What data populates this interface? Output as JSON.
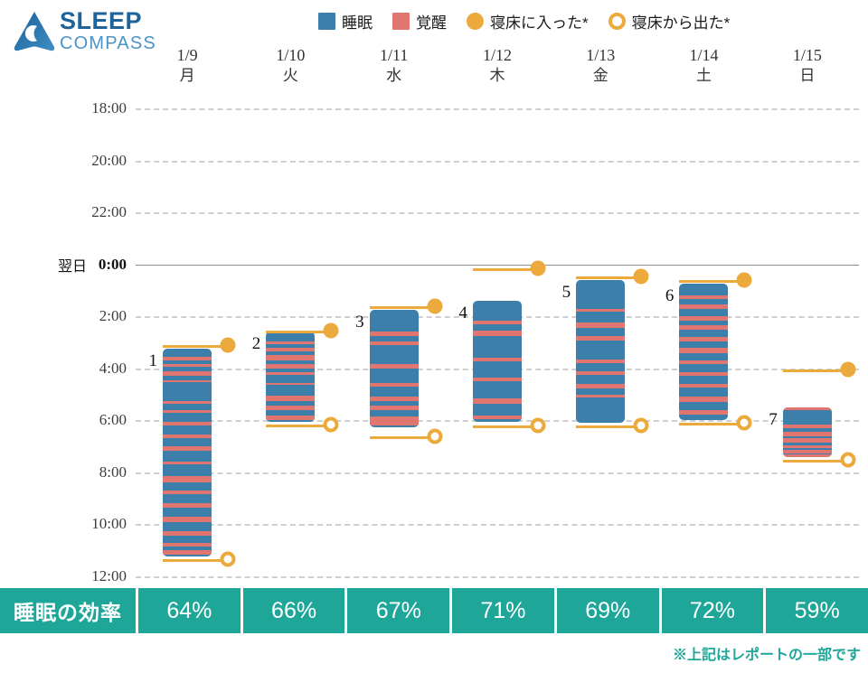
{
  "brand": {
    "name_line1": "SLEEP",
    "name_line2": "COMPASS",
    "logo_icon": "sleep-compass-moon-arrow-logo",
    "color_primary": "#1f6398",
    "color_secondary": "#4b94c8"
  },
  "legend": {
    "items": [
      {
        "label": "睡眠",
        "marker": "square",
        "color": "#3d7fab",
        "icon": "sleep-swatch-icon"
      },
      {
        "label": "覚醒",
        "marker": "square",
        "color": "#e0766f",
        "icon": "awake-swatch-icon"
      },
      {
        "label": "寝床に入った*",
        "marker": "dot-filled",
        "color": "#eca93c",
        "icon": "bed-in-dot-icon"
      },
      {
        "label": "寝床から出た*",
        "marker": "dot-hollow",
        "color": "#eca93c",
        "icon": "bed-out-dot-icon"
      }
    ]
  },
  "efficiency_row": {
    "label": "睡眠の効率",
    "values": [
      "64%",
      "66%",
      "67%",
      "71%",
      "69%",
      "72%",
      "59%"
    ],
    "color": "#1ea699"
  },
  "footer": {
    "note": "※上記はレポートの一部です",
    "color": "#1ea699"
  },
  "chart_data": {
    "type": "bar",
    "title": "",
    "subtitle": "",
    "xlabel": "",
    "ylabel": "",
    "grid": true,
    "legend_position": "top",
    "next_day_marker": "翌日",
    "next_day_marker_at": "0:00",
    "categories": [
      "1/9",
      "1/10",
      "1/11",
      "1/12",
      "1/13",
      "1/14",
      "1/15"
    ],
    "day_of_week": [
      "月",
      "火",
      "水",
      "木",
      "金",
      "土",
      "日"
    ],
    "ytick_labels": [
      "18:00",
      "20:00",
      "22:00",
      "0:00",
      "2:00",
      "4:00",
      "6:00",
      "8:00",
      "10:00",
      "12:00"
    ],
    "ytick_hours": [
      18,
      20,
      22,
      24,
      26,
      28,
      30,
      32,
      34,
      36
    ],
    "ylim_hours": [
      18,
      36
    ],
    "y_axis_note": "hours measured from 18:00 of the labelled day; 24 = 0:00 next day",
    "sleep_color": "#3d7fab",
    "awake_color": "#e0766f",
    "marker_color": "#eca93c",
    "series": [
      {
        "name": "1/9",
        "index_label": "1",
        "bed_in_hour": 27.1,
        "bed_out_hour": 35.35,
        "sleep_start_hour": 27.25,
        "sleep_end_hour": 35.25,
        "efficiency": "64%",
        "awake_segments": [
          [
            27.55,
            27.68
          ],
          [
            27.82,
            27.95
          ],
          [
            28.1,
            28.3
          ],
          [
            28.45,
            28.52
          ],
          [
            29.25,
            29.38
          ],
          [
            29.6,
            29.72
          ],
          [
            30.05,
            30.2
          ],
          [
            30.55,
            30.68
          ],
          [
            31.0,
            31.18
          ],
          [
            31.6,
            31.7
          ],
          [
            32.15,
            32.4
          ],
          [
            32.7,
            32.85
          ],
          [
            33.2,
            33.35
          ],
          [
            33.7,
            33.92
          ],
          [
            34.25,
            34.45
          ],
          [
            34.7,
            34.85
          ],
          [
            35.0,
            35.15
          ]
        ]
      },
      {
        "name": "1/10",
        "index_label": "2",
        "bed_in_hour": 26.55,
        "bed_out_hour": 30.15,
        "sleep_start_hour": 26.6,
        "sleep_end_hour": 30.05,
        "efficiency": "66%",
        "awake_segments": [
          [
            26.95,
            27.08
          ],
          [
            27.2,
            27.35
          ],
          [
            27.5,
            27.7
          ],
          [
            27.85,
            28.0
          ],
          [
            28.15,
            28.25
          ],
          [
            28.55,
            28.65
          ],
          [
            29.05,
            29.25
          ],
          [
            29.45,
            29.62
          ],
          [
            29.8,
            29.98
          ]
        ]
      },
      {
        "name": "1/11",
        "index_label": "3",
        "bed_in_hour": 25.6,
        "bed_out_hour": 30.6,
        "sleep_start_hour": 25.75,
        "sleep_end_hour": 30.25,
        "efficiency": "67%",
        "awake_segments": [
          [
            26.6,
            26.75
          ],
          [
            26.95,
            27.12
          ],
          [
            27.85,
            28.0
          ],
          [
            28.55,
            28.7
          ],
          [
            29.1,
            29.25
          ],
          [
            29.45,
            29.62
          ],
          [
            29.85,
            30.2
          ]
        ]
      },
      {
        "name": "1/12",
        "index_label": "4",
        "bed_in_hour": 24.15,
        "bed_out_hour": 30.2,
        "sleep_start_hour": 25.4,
        "sleep_end_hour": 30.05,
        "efficiency": "71%",
        "awake_segments": [
          [
            26.15,
            26.3
          ],
          [
            26.55,
            26.75
          ],
          [
            27.6,
            27.72
          ],
          [
            28.35,
            28.48
          ],
          [
            29.15,
            29.35
          ],
          [
            29.8,
            29.95
          ]
        ]
      },
      {
        "name": "1/13",
        "index_label": "5",
        "bed_in_hour": 24.45,
        "bed_out_hour": 30.2,
        "sleep_start_hour": 24.6,
        "sleep_end_hour": 30.1,
        "efficiency": "69%",
        "awake_segments": [
          [
            25.7,
            25.82
          ],
          [
            26.25,
            26.45
          ],
          [
            26.75,
            26.92
          ],
          [
            27.65,
            27.8
          ],
          [
            28.1,
            28.25
          ],
          [
            28.6,
            28.78
          ],
          [
            29.0,
            29.12
          ]
        ]
      },
      {
        "name": "1/14",
        "index_label": "6",
        "bed_in_hour": 24.6,
        "bed_out_hour": 30.1,
        "sleep_start_hour": 24.75,
        "sleep_end_hour": 30.0,
        "efficiency": "72%",
        "awake_segments": [
          [
            25.2,
            25.32
          ],
          [
            25.55,
            25.72
          ],
          [
            26.0,
            26.15
          ],
          [
            26.35,
            26.5
          ],
          [
            26.8,
            26.95
          ],
          [
            27.2,
            27.4
          ],
          [
            27.7,
            27.85
          ],
          [
            28.15,
            28.3
          ],
          [
            28.6,
            28.75
          ],
          [
            29.1,
            29.28
          ],
          [
            29.6,
            29.78
          ]
        ]
      },
      {
        "name": "1/15",
        "index_label": "7",
        "bed_in_hour": 28.05,
        "bed_out_hour": 31.5,
        "sleep_start_hour": 29.5,
        "sleep_end_hour": 31.4,
        "efficiency": "59%",
        "awake_segments": [
          [
            29.5,
            29.62
          ],
          [
            30.15,
            30.3
          ],
          [
            30.45,
            30.6
          ],
          [
            30.7,
            30.85
          ],
          [
            30.95,
            31.08
          ],
          [
            31.15,
            31.28
          ],
          [
            31.32,
            31.4
          ]
        ]
      }
    ]
  }
}
